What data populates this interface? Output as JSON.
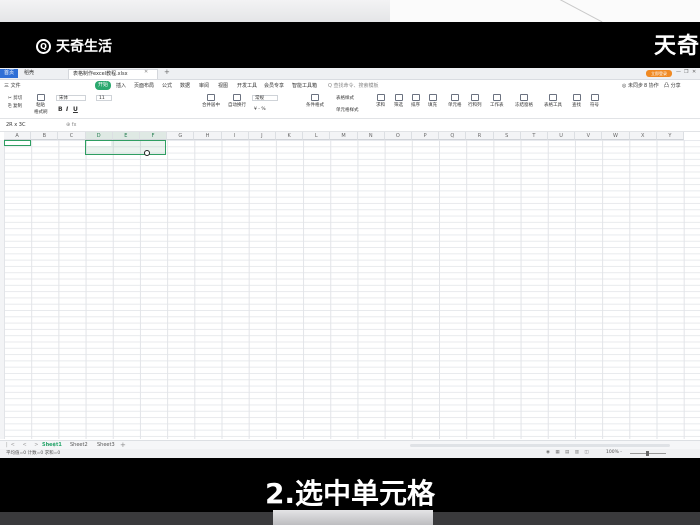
{
  "overlay": {
    "logo_text": "天奇生活",
    "logo_mark": "Q",
    "corner_brand": "天奇",
    "caption": "2.选中单元格"
  },
  "tabs": [
    {
      "label": "首页"
    },
    {
      "label": "稻壳"
    },
    {
      "label": "表格制作excel教程.xlsx"
    }
  ],
  "tab_close": "✕",
  "tab_add": "+",
  "window": {
    "login_label": "立即登录",
    "minimize": "—",
    "restore": "❐",
    "close": "✕"
  },
  "menu": {
    "items": [
      "三 文件",
      "插入",
      "页面布局",
      "公式",
      "数据",
      "审阅",
      "视图",
      "开发工具",
      "会员专享",
      "智能工具箱"
    ],
    "start": "开始",
    "search": "Q 查找命令、搜索模板",
    "right_items": [
      "◎ 未同步",
      "8 协作",
      "凸 分享"
    ]
  },
  "ribbon": {
    "cut": "✂ 剪切",
    "copy": "⎘ 复制",
    "format_painter": "格式刷",
    "paste": "粘贴",
    "font_name": "宋体",
    "font_size": "11",
    "bold": "B",
    "italic": "I",
    "underline": "U",
    "merge": "合并居中",
    "wrap": "自动换行",
    "number_format": "常规",
    "percent": "¥ - %",
    "table_style": "表格样式",
    "conditional": "条件格式",
    "cell_style": "单元格样式",
    "sum": "求和",
    "filter": "筛选",
    "sort": "排序",
    "fill": "填充",
    "cell": "单元格",
    "rowcol": "行和列",
    "worksheet": "工作表",
    "freeze": "冻结窗格",
    "table_tools": "表格工具",
    "find": "查找",
    "symbol": "符号"
  },
  "formula_bar": {
    "name_box": "2R x 3C",
    "fx": "⊕ fx"
  },
  "grid": {
    "columns": [
      "A",
      "B",
      "C",
      "D",
      "E",
      "F",
      "G",
      "H",
      "I",
      "J",
      "K",
      "L",
      "M",
      "N",
      "O",
      "P",
      "Q",
      "R",
      "S",
      "T",
      "U",
      "V",
      "W",
      "X",
      "Y"
    ],
    "selected_columns": [
      "D",
      "E",
      "F"
    ]
  },
  "sheets": {
    "nav": "|< < > >|",
    "tabs": [
      "Sheet1",
      "Sheet2",
      "Sheet3"
    ],
    "active": "Sheet1",
    "add": "+"
  },
  "status": {
    "left": "平均值=0  计数=0  求和=0",
    "icons": "◉ ▦ ▤ ▥ ◫",
    "zoom": "100% -"
  }
}
